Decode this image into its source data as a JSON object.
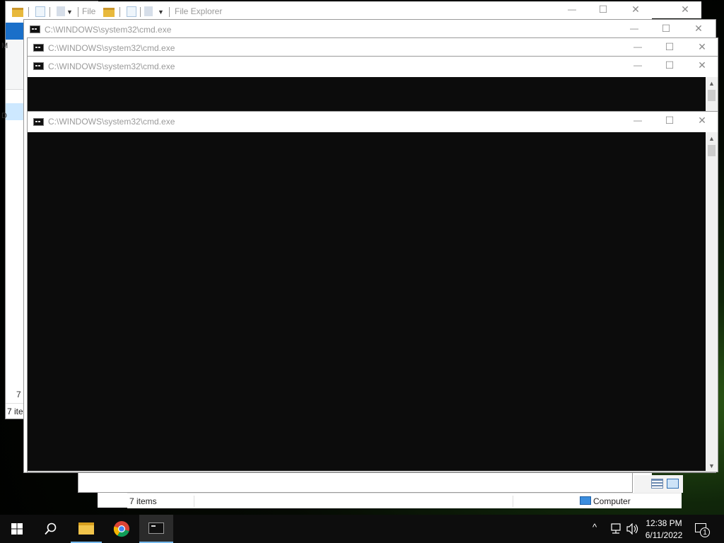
{
  "desktop": {},
  "explorer_back": {
    "title_partial": "File",
    "status_partial": "7 ite",
    "left_count_partial": "7",
    "sidebar_partial_m": "M",
    "sidebar_partial_d": "D"
  },
  "explorer_main": {
    "title": "File Explorer",
    "status_items": "7 items",
    "status_location": "Computer"
  },
  "cmd_windows": [
    {
      "title": "C:\\WINDOWS\\system32\\cmd.exe"
    },
    {
      "title": "C:\\WINDOWS\\system32\\cmd.exe"
    },
    {
      "title": "C:\\WINDOWS\\system32\\cmd.exe"
    },
    {
      "title": "C:\\WINDOWS\\system32\\cmd.exe"
    }
  ],
  "window_controls": {
    "minimize": "—",
    "maximize": "☐",
    "close": "✕"
  },
  "taskbar": {
    "time": "12:38 PM",
    "date": "6/11/2022",
    "notification_count": "1",
    "apps": [
      "file-explorer",
      "chrome",
      "cmd"
    ]
  },
  "colors": {
    "console_bg": "#0c0c0c",
    "taskbar_bg": "#0d0d0d",
    "accent": "#76b9ed",
    "explorer_blue": "#1a6fc9"
  }
}
